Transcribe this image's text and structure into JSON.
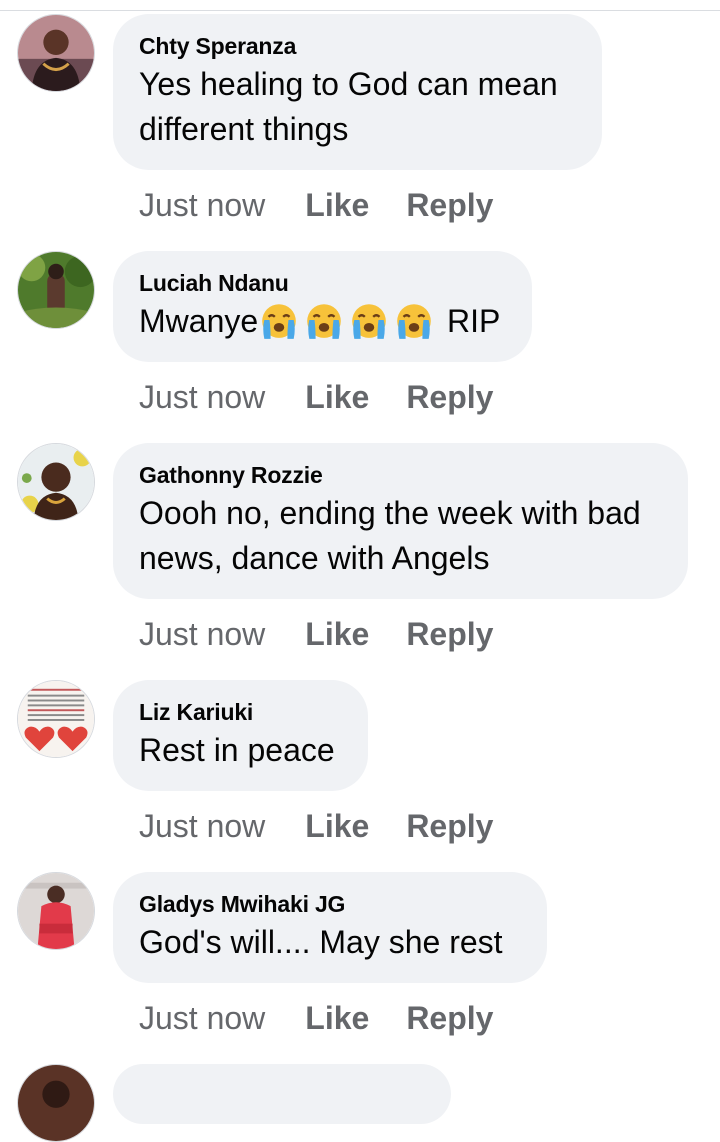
{
  "comments": [
    {
      "author": "Chty Speranza",
      "text_lines": [
        "Yes healing to God can mean",
        "different things"
      ],
      "time": "Just now",
      "like": "Like",
      "reply": "Reply"
    },
    {
      "author": "Luciah Ndanu",
      "text_prefix": "Mwanye",
      "emoji": [
        "crying-face-emoji",
        "crying-face-emoji",
        "crying-face-emoji",
        "crying-face-emoji"
      ],
      "text_suffix": " RIP",
      "time": "Just now",
      "like": "Like",
      "reply": "Reply"
    },
    {
      "author": "Gathonny Rozzie",
      "text_lines": [
        "Oooh no, ending the week with bad",
        "news, dance with Angels"
      ],
      "time": "Just now",
      "like": "Like",
      "reply": "Reply"
    },
    {
      "author": "Liz Kariuki",
      "text_lines": [
        "Rest in peace"
      ],
      "time": "Just now",
      "like": "Like",
      "reply": "Reply"
    },
    {
      "author": "Gladys Mwihaki JG",
      "text_lines": [
        "God's will.... May she rest"
      ],
      "time": "Just now",
      "like": "Like",
      "reply": "Reply"
    }
  ],
  "colors": {
    "bubble": "#f0f2f5",
    "secondary_text": "#65676b",
    "primary_text": "#050505"
  }
}
